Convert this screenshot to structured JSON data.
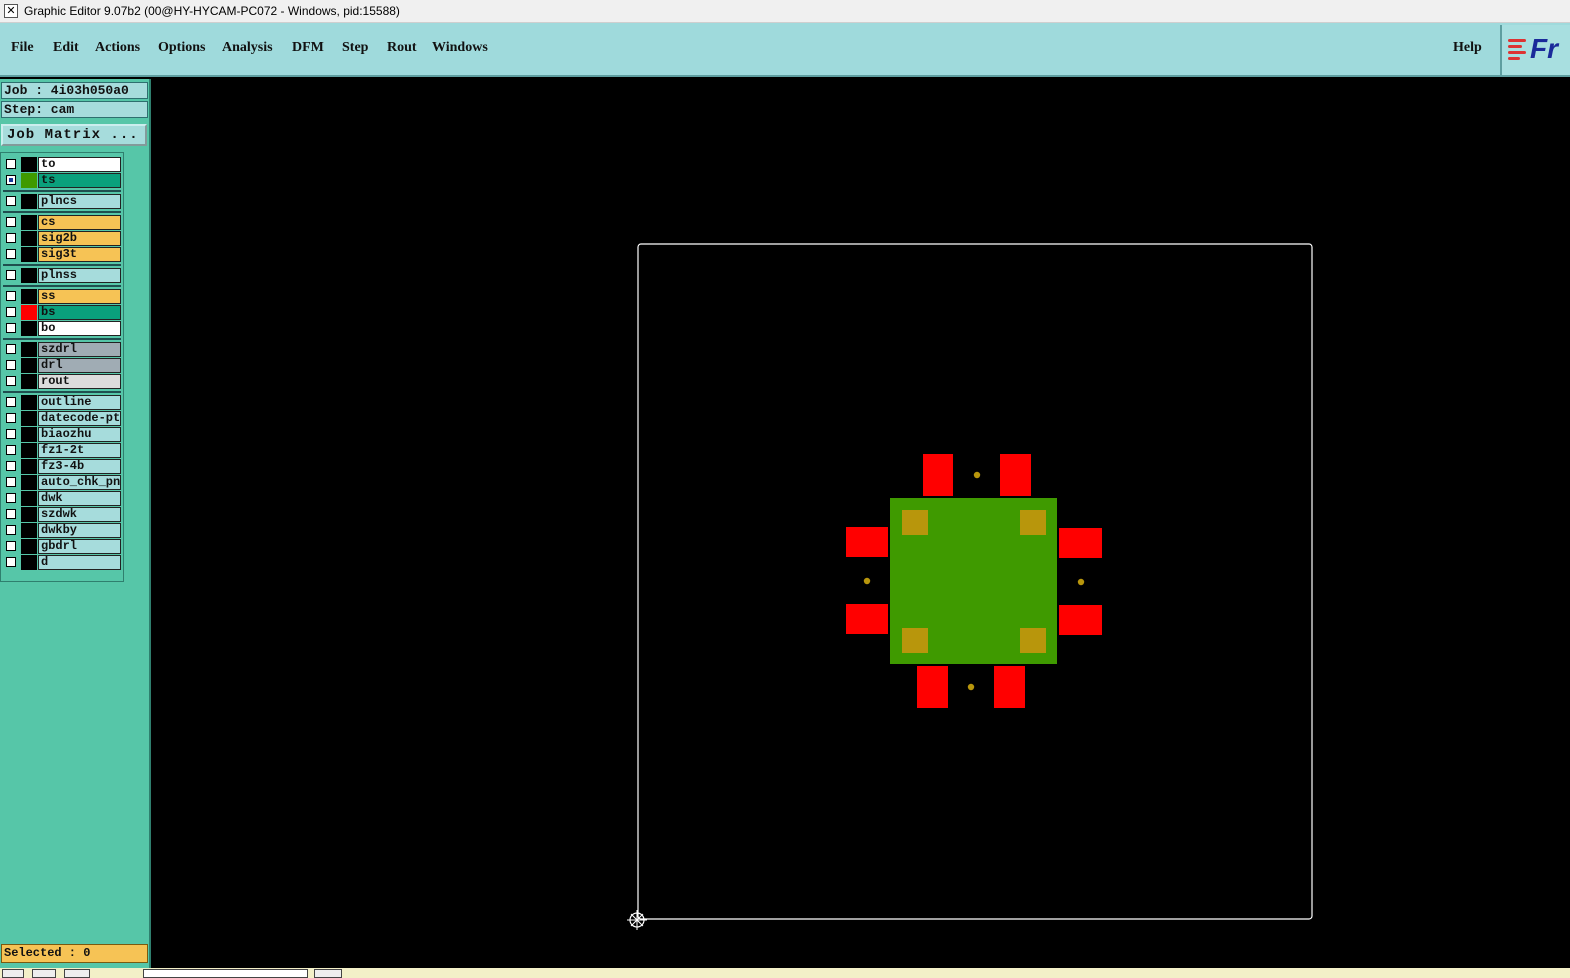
{
  "window": {
    "title": "Graphic Editor 9.07b2 (00@HY-HYCAM-PC072 - Windows, pid:15588)",
    "app_icon": "x-window-icon"
  },
  "menu": {
    "items": [
      "File",
      "Edit",
      "Actions",
      "Options",
      "Analysis",
      "DFM",
      "Step",
      "Rout",
      "Windows"
    ],
    "help": "Help",
    "logo_text": "Fr"
  },
  "panel": {
    "job": "Job : 4i03h050a0",
    "step": "Step: cam",
    "job_matrix": "Job Matrix ...",
    "selected": "Selected : 0"
  },
  "layers": [
    {
      "name": "to",
      "color": "#ffffff",
      "swatch": "#000000",
      "active": false,
      "group": 0
    },
    {
      "name": "ts",
      "color": "#0aa07c",
      "swatch": "#3f9a00",
      "active": true,
      "group": 0
    },
    {
      "name": "plncs",
      "color": "#a6dcdc",
      "swatch": "#000000",
      "active": false,
      "group": 1
    },
    {
      "name": "cs",
      "color": "#f6c355",
      "swatch": "#000000",
      "active": false,
      "group": 2
    },
    {
      "name": "sig2b",
      "color": "#f6c355",
      "swatch": "#000000",
      "active": false,
      "group": 2
    },
    {
      "name": "sig3t",
      "color": "#f6c355",
      "swatch": "#000000",
      "active": false,
      "group": 2
    },
    {
      "name": "plnss",
      "color": "#a6dcdc",
      "swatch": "#000000",
      "active": false,
      "group": 3
    },
    {
      "name": "ss",
      "color": "#f6c355",
      "swatch": "#000000",
      "active": false,
      "group": 4
    },
    {
      "name": "bs",
      "color": "#0aa07c",
      "swatch": "#ff0000",
      "active": false,
      "group": 4
    },
    {
      "name": "bo",
      "color": "#ffffff",
      "swatch": "#000000",
      "active": false,
      "group": 4
    },
    {
      "name": "szdrl",
      "color": "#a0acb4",
      "swatch": "#000000",
      "active": false,
      "group": 5
    },
    {
      "name": "drl",
      "color": "#a0acb4",
      "swatch": "#000000",
      "active": false,
      "group": 5
    },
    {
      "name": "rout",
      "color": "#dcdcdc",
      "swatch": "#000000",
      "active": false,
      "group": 5
    },
    {
      "name": "outline",
      "color": "#a6dcdc",
      "swatch": "#000000",
      "active": false,
      "group": 6
    },
    {
      "name": "datecode-pte",
      "color": "#a6dcdc",
      "swatch": "#000000",
      "active": false,
      "group": 6
    },
    {
      "name": "biaozhu",
      "color": "#a6dcdc",
      "swatch": "#000000",
      "active": false,
      "group": 6
    },
    {
      "name": "fz1-2t",
      "color": "#a6dcdc",
      "swatch": "#000000",
      "active": false,
      "group": 6
    },
    {
      "name": "fz3-4b",
      "color": "#a6dcdc",
      "swatch": "#000000",
      "active": false,
      "group": 6
    },
    {
      "name": "auto_chk_pnl",
      "color": "#a6dcdc",
      "swatch": "#000000",
      "active": false,
      "group": 6
    },
    {
      "name": "dwk",
      "color": "#a6dcdc",
      "swatch": "#000000",
      "active": false,
      "group": 6
    },
    {
      "name": "szdwk",
      "color": "#a6dcdc",
      "swatch": "#000000",
      "active": false,
      "group": 6
    },
    {
      "name": "dwkby",
      "color": "#a6dcdc",
      "swatch": "#000000",
      "active": false,
      "group": 6
    },
    {
      "name": "gbdrl",
      "color": "#a6dcdc",
      "swatch": "#000000",
      "active": false,
      "group": 6
    },
    {
      "name": "d",
      "color": "#a6dcdc",
      "swatch": "#000000",
      "active": false,
      "group": 6
    }
  ],
  "colors": {
    "menu_bg": "#9fdadc",
    "panel_bg": "#56c6a8",
    "canvas_bg": "#000000",
    "outline": "#ffffff",
    "pad_red": "#ff0000",
    "board_green": "#3f9a00",
    "pad_gold": "#b8960c"
  },
  "icons": {
    "origin_marker": "origin-crosshair-icon"
  }
}
